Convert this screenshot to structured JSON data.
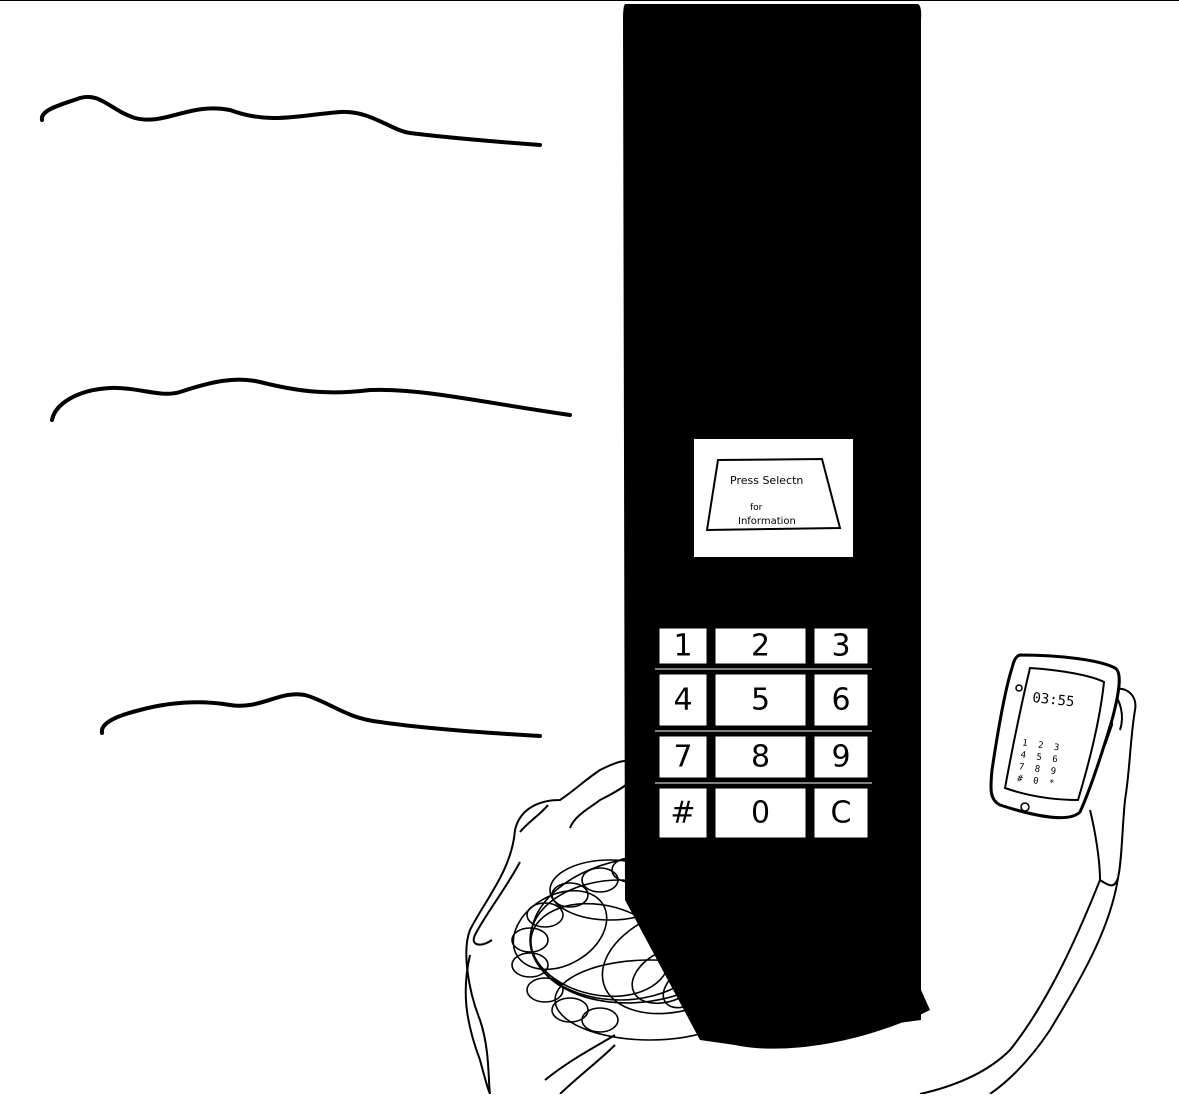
{
  "kiosk": {
    "screen": {
      "line1": "Press Selectn",
      "line2": "for",
      "line3": "Information"
    },
    "keypad": {
      "keys": [
        "1",
        "2",
        "3",
        "4",
        "5",
        "6",
        "7",
        "8",
        "9",
        "#",
        "0",
        "C"
      ]
    }
  },
  "phone": {
    "time": "03:55",
    "keys": [
      "1",
      "2",
      "3",
      "4",
      "5",
      "6",
      "7",
      "8",
      "9",
      "#",
      "0",
      "*"
    ]
  },
  "colors": {
    "ink": "#000000",
    "paper": "#ffffff"
  }
}
